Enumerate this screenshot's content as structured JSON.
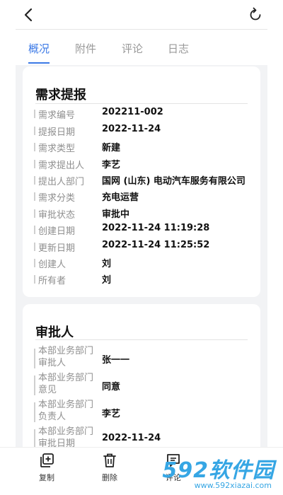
{
  "tabs": [
    {
      "label": "概况",
      "active": true
    },
    {
      "label": "附件",
      "active": false
    },
    {
      "label": "评论",
      "active": false
    },
    {
      "label": "日志",
      "active": false
    }
  ],
  "request_card": {
    "title": "需求提报",
    "fields": [
      {
        "label": "需求编号",
        "value": "202211-002"
      },
      {
        "label": "提报日期",
        "value": "2022-11-24"
      },
      {
        "label": "需求类型",
        "value": "新建"
      },
      {
        "label": "需求提出人",
        "value": "李艺"
      },
      {
        "label": "提出人部门",
        "value": "国网 (山东) 电动汽车服务有限公司"
      },
      {
        "label": "需求分类",
        "value": "充电运营"
      },
      {
        "label": "审批状态",
        "value": "审批中"
      },
      {
        "label": "创建日期",
        "value": "2022-11-24 11:19:28"
      },
      {
        "label": "更新日期",
        "value": "2022-11-24 11:25:52"
      },
      {
        "label": "创建人",
        "value": "刘"
      },
      {
        "label": "所有者",
        "value": "刘"
      }
    ]
  },
  "approver_card": {
    "title": "审批人",
    "fields": [
      {
        "label": "本部业务部门审批人",
        "value": "张一一"
      },
      {
        "label": "本部业务部门意见",
        "value": "同意"
      },
      {
        "label": "本部业务部门负责人",
        "value": "李艺"
      },
      {
        "label": "本部业务部门审批日期",
        "value": "2022-11-24"
      }
    ]
  },
  "actions": [
    {
      "label": "复制"
    },
    {
      "label": "删除"
    },
    {
      "label": "评论"
    }
  ],
  "watermark": {
    "brand": "592软件园",
    "url": "www.592xiazai.com"
  },
  "colors": {
    "accent": "#3b79e6",
    "background": "#f2f3f5",
    "watermark": "#36a6e4"
  }
}
